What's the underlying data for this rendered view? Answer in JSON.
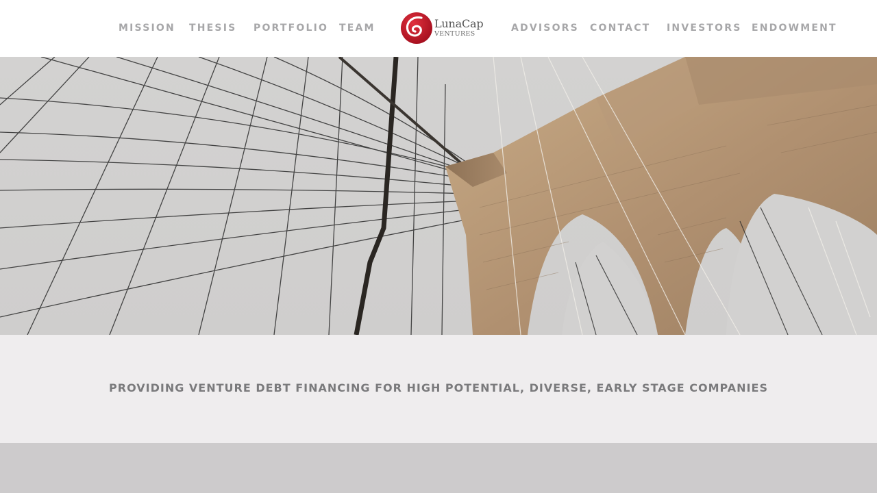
{
  "nav": {
    "left": [
      {
        "label": "MISSION"
      },
      {
        "label": "THESIS"
      },
      {
        "label": "PORTFOLIO"
      },
      {
        "label": "TEAM"
      }
    ],
    "right": [
      {
        "label": "ADVISORS"
      },
      {
        "label": "CONTACT"
      },
      {
        "label": "INVESTORS"
      },
      {
        "label": "ENDOWMENT"
      }
    ]
  },
  "logo": {
    "line1": "LunaCap",
    "line2": "VENTURES",
    "icon": "red-swirl-logo-icon",
    "accent_color": "#c0182a"
  },
  "hero": {
    "subject": "suspension-bridge-image"
  },
  "tagline": {
    "text": "PROVIDING VENTURE DEBT FINANCING FOR HIGH POTENTIAL, DIVERSE, EARLY STAGE COMPANIES"
  },
  "colors": {
    "nav_text": "#a7a7a9",
    "tagline_text": "#7a7a7c",
    "tagline_band": "#efedee",
    "bottom_band": "#cdcbcc",
    "stone": "#b89b7a"
  }
}
